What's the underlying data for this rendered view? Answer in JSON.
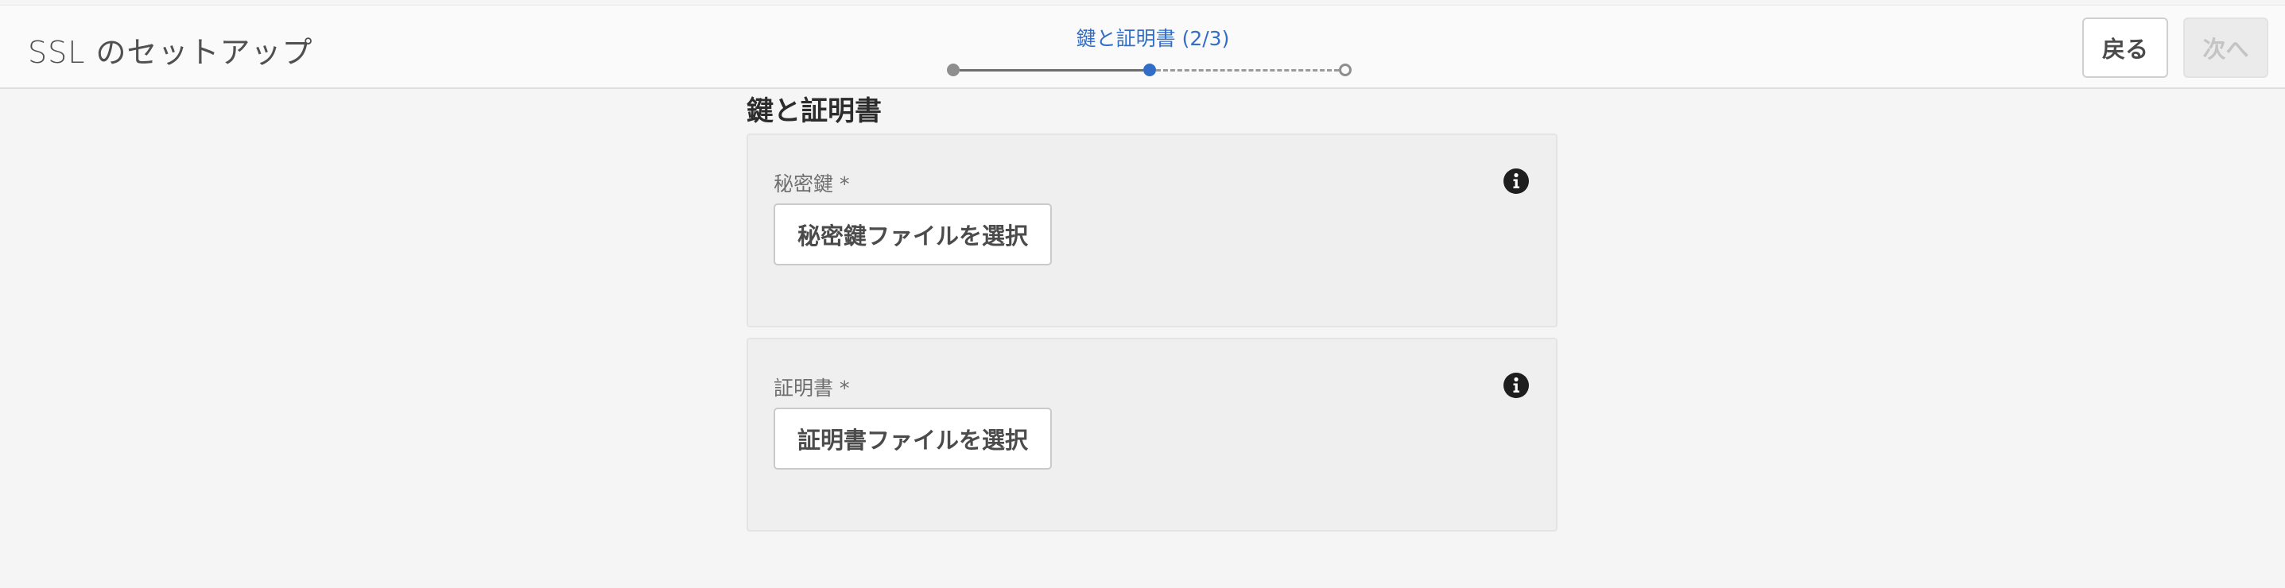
{
  "header": {
    "title": "SSL のセットアップ",
    "step_label": "鍵と証明書 (2/3)",
    "back_label": "戻る",
    "next_label": "次へ"
  },
  "stepper": {
    "current_step": 2,
    "total_steps": 3,
    "accent_color": "#326ec8"
  },
  "main": {
    "heading": "鍵と証明書",
    "cards": [
      {
        "label": "秘密鍵 *",
        "button_label": "秘密鍵ファイルを選択",
        "icon": "info-icon"
      },
      {
        "label": "証明書 *",
        "button_label": "証明書ファイルを選択",
        "icon": "info-icon"
      }
    ]
  }
}
